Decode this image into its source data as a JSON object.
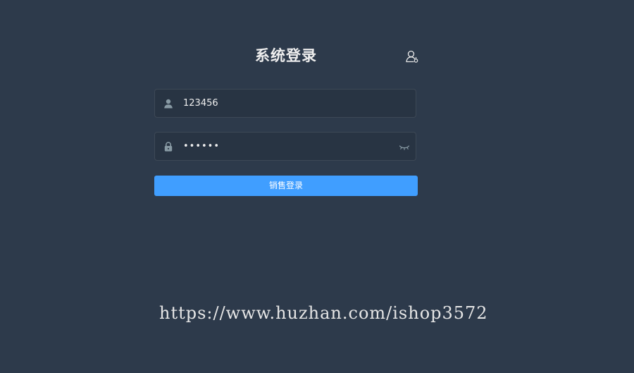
{
  "login": {
    "title": "系统登录",
    "username": {
      "value": "123456",
      "icon": "user-icon"
    },
    "password": {
      "value": "123456",
      "icon": "lock-icon",
      "toggle_icon": "eye-closed-icon"
    },
    "switch_icon": "user-switch-icon",
    "submit_label": "销售登录"
  },
  "watermark": {
    "text": "https://www.huzhan.com/ishop3572"
  },
  "colors": {
    "background": "#2d3a4b",
    "field_background": "#283443",
    "primary": "#409eff",
    "text": "#eeeeee"
  }
}
